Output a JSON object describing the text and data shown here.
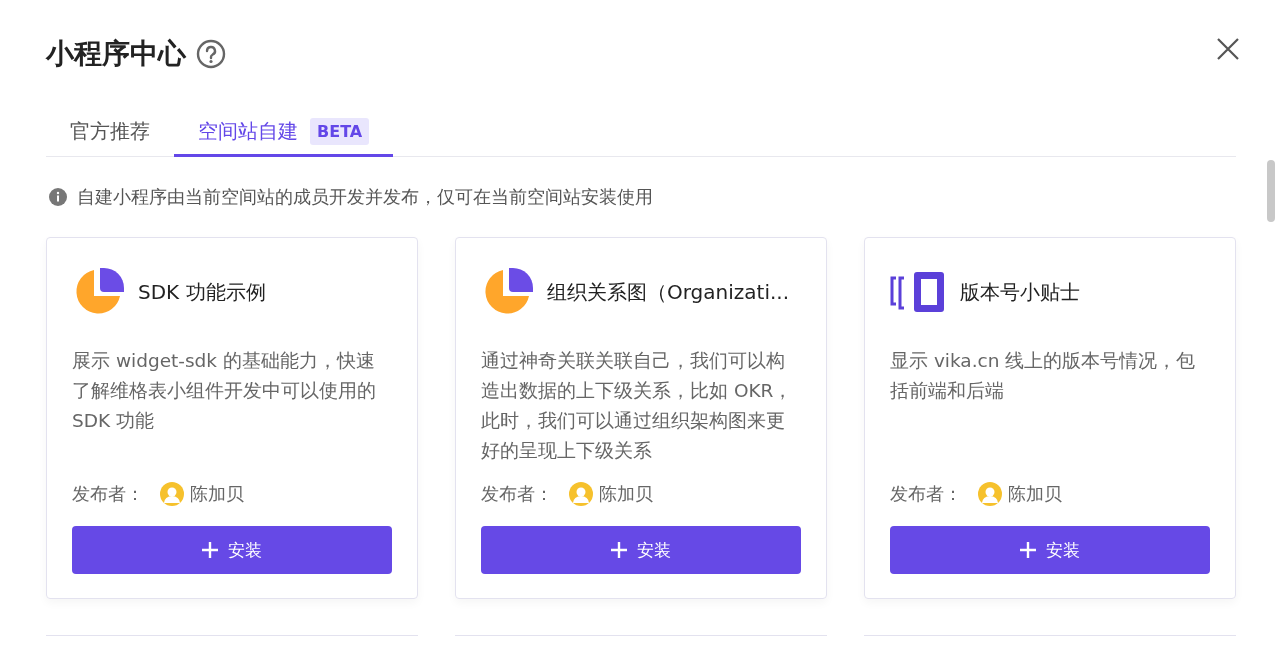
{
  "title": "小程序中心",
  "tabs": [
    {
      "label": "官方推荐",
      "selected": false
    },
    {
      "label": "空间站自建",
      "selected": true,
      "badge": "BETA"
    }
  ],
  "notice": "自建小程序由当前空间站的成员开发并发布，仅可在当前空间站安装使用",
  "widgets": [
    {
      "kind": "pie",
      "name": "SDK 功能示例",
      "description": "展示 widget-sdk 的基础能力，快速了解维格表小组件开发中可以使用的 SDK 功能",
      "publisher_label": "发布者：",
      "publisher": "陈加贝",
      "button": "安装"
    },
    {
      "kind": "pie",
      "name": "组织关系图（Organizati...",
      "description": "通过神奇关联关联自己，我们可以构造出数据的上下级关系，比如 OKR，此时，我们可以通过组织架构图来更好的呈现上下级关系",
      "publisher_label": "发布者：",
      "publisher": "陈加贝",
      "button": "安装"
    },
    {
      "kind": "bracket",
      "name": "版本号小贴士",
      "description": "显示 vika.cn 线上的版本号情况，包括前端和后端",
      "publisher_label": "发布者：",
      "publisher": "陈加贝",
      "button": "安装"
    }
  ]
}
